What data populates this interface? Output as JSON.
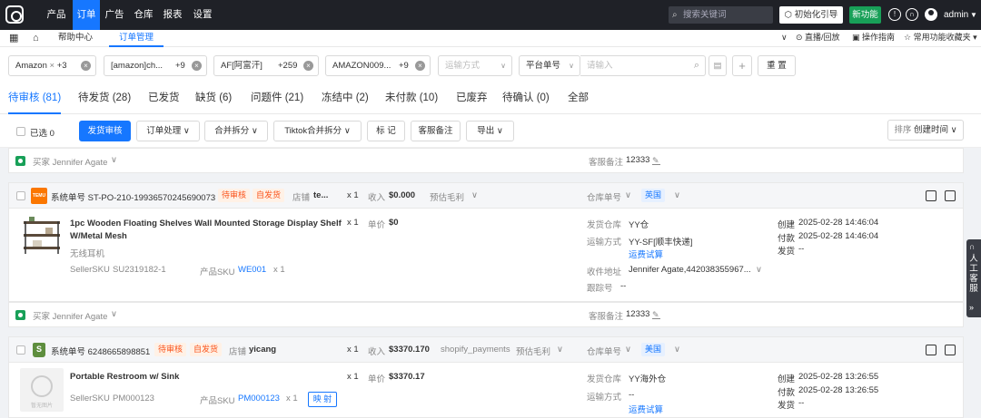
{
  "topnav": {
    "items": [
      "产品",
      "订单",
      "广告",
      "仓库",
      "报表",
      "设置"
    ],
    "active_index": 1,
    "search_placeholder": "搜索关键词",
    "init_guide": "初始化引导",
    "new_func": "新功能",
    "user": "admin"
  },
  "subnav": {
    "tabs": [
      "帮助中心",
      "订单管理"
    ],
    "active_index": 1,
    "links": [
      "直播/回放",
      "操作指南",
      "常用功能收藏夹"
    ]
  },
  "filters": {
    "tags": [
      {
        "label": "Amazon",
        "count": "+3"
      },
      {
        "label": "[amazon]ch...",
        "count": "+9"
      },
      {
        "label": "AF[阿富汗]",
        "count": "+259"
      },
      {
        "label": "AMAZON009...",
        "count": "+9"
      }
    ],
    "shipping_method_placeholder": "运输方式",
    "search_field": "平台单号",
    "search_placeholder": "请输入",
    "reset": "重 置"
  },
  "status_tabs": [
    {
      "label": "待审核 (81)"
    },
    {
      "label": "待发货 (28)"
    },
    {
      "label": "已发货"
    },
    {
      "label": "缺货 (6)"
    },
    {
      "label": "问题件 (21)"
    },
    {
      "label": "冻结中 (2)"
    },
    {
      "label": "未付款 (10)"
    },
    {
      "label": "已废弃"
    },
    {
      "label": "待确认 (0)"
    },
    {
      "label": "全部"
    }
  ],
  "actions": {
    "selected": "已选 0",
    "buttons": [
      "发货审核",
      "订单处理",
      "合并拆分",
      "Tiktok合并拆分",
      "标 记",
      "客服备注",
      "导出"
    ],
    "sort_label": "排序",
    "sort_value": "创建时间"
  },
  "orders": [
    {
      "buyer": "买家 Jennifer Agate",
      "cs_note_label": "客服备注",
      "cs_note": "12333",
      "platform": "TEMU",
      "sys_no": "系统单号 ST-PO-210-19936570245690073",
      "status": "待审核",
      "ship_tag": "自发货",
      "store_label": "店铺",
      "store": "te...",
      "qty": "x 1",
      "income_label": "收入",
      "income": "$0.000",
      "pay_method": "",
      "profit_label": "预估毛利",
      "warehouse_label": "仓库单号",
      "country": "英国",
      "product": {
        "title": "1pc Wooden Floating Shelves Wall Mounted Storage Display Shelf W/Metal Mesh",
        "subtitle": "无线耳机",
        "seller_sku_label": "SellerSKU",
        "seller_sku": "SU2319182-1",
        "product_sku_label": "产品SKU",
        "product_sku": "WE001",
        "sku_qty": "x 1",
        "qty": "x 1",
        "price_label": "单价",
        "price": "$0",
        "map_btn": ""
      },
      "ship_warehouse_label": "发货仓库",
      "ship_warehouse": "YY仓",
      "ship_method_label": "运输方式",
      "ship_method": "YY-SF[顺丰快递]",
      "freight_trial": "运费试算",
      "address_label": "收件地址",
      "address": "Jennifer Agate,442038355967...",
      "tracking_label": "跟踪号",
      "tracking": "--",
      "created_label": "创建",
      "created": "2025-02-28 14:46:04",
      "paid_label": "付款",
      "paid": "2025-02-28 14:46:04",
      "shipped_label": "发货",
      "shipped": "--"
    },
    {
      "buyer": "买家 Jennifer Agate",
      "cs_note_label": "客服备注",
      "cs_note": "12333",
      "platform": "shopify",
      "sys_no": "系统单号 6248665898851",
      "status": "待审核",
      "ship_tag": "自发货",
      "store_label": "店铺",
      "store": "yicang",
      "qty": "x 1",
      "income_label": "收入",
      "income": "$3370.170",
      "pay_method": "shopify_payments",
      "profit_label": "预估毛利",
      "warehouse_label": "仓库单号",
      "country": "美国",
      "product": {
        "title": "Portable Restroom w/ Sink",
        "subtitle": "",
        "seller_sku_label": "SellerSKU",
        "seller_sku": "PM000123",
        "product_sku_label": "产品SKU",
        "product_sku": "PM000123",
        "sku_qty": "x 1",
        "qty": "x 1",
        "price_label": "单价",
        "price": "$3370.17",
        "map_btn": "映 射",
        "img_placeholder": "暂无图片"
      },
      "ship_warehouse_label": "发货仓库",
      "ship_warehouse": "YY海外仓",
      "ship_method_label": "运输方式",
      "ship_method": "--",
      "freight_trial": "运费试算",
      "created_label": "创建",
      "created": "2025-02-28 13:26:55",
      "paid_label": "付款",
      "paid": "2025-02-28 13:26:55",
      "shipped_label": "发货",
      "shipped": "--"
    }
  ],
  "service": {
    "label": "人工客服"
  }
}
